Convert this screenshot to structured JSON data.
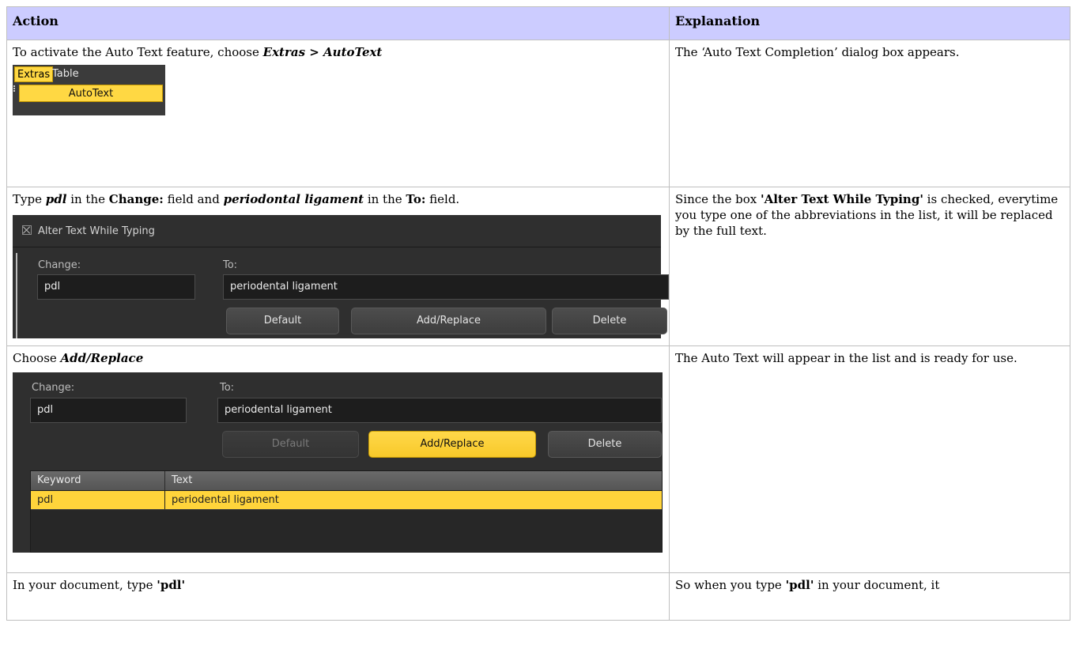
{
  "table": {
    "headers": {
      "action": "Action",
      "explanation": "Explanation"
    },
    "rows": [
      {
        "action_text": "To activate the Auto Text feature, choose ",
        "action_emph": "Extras > AutoText",
        "explanation": "The ‘Auto Text Completion’ dialog box appears.",
        "menu": {
          "extras": "Extras",
          "table": "Table",
          "autotext": "AutoText"
        }
      },
      {
        "action_t1": "Type ",
        "action_e1": "pdl",
        "action_t2": " in the ",
        "action_b1": "Change:",
        "action_t3": " field and ",
        "action_e2": "periodontal ligament",
        "action_t4": " in the ",
        "action_b2": "To:",
        "action_t5": " field.",
        "expl_t1": "Since the box ",
        "expl_b1": "'Alter Text While Typing'",
        "expl_t2": " is checked, everytime you type one of the abbreviations in the list, it will be replaced by the full text.",
        "dialog": {
          "checkbox_label": "Alter Text While Typing",
          "change_label": "Change:",
          "to_label": "To:",
          "change_value": "pdl",
          "to_value": "periodental ligament",
          "btn_default": "Default",
          "btn_add": "Add/Replace",
          "btn_delete": "Delete"
        }
      },
      {
        "action_t1": "Choose ",
        "action_e1": "Add/Replace",
        "explanation": "The Auto Text will appear in the list and is ready for use.",
        "dialog": {
          "change_label": "Change:",
          "to_label": "To:",
          "change_value": "pdl",
          "to_value": "periodental ligament",
          "btn_default": "Default",
          "btn_add": "Add/Replace",
          "btn_delete": "Delete",
          "col_keyword": "Keyword",
          "col_text": "Text",
          "row_keyword": "pdl",
          "row_text": "periodental ligament"
        }
      },
      {
        "action_t1": "In your document, type ",
        "action_b1": "'pdl'",
        "expl_t1": "So when you type ",
        "expl_b1": "'pdl'",
        "expl_t2": " in your document, it"
      }
    ]
  }
}
